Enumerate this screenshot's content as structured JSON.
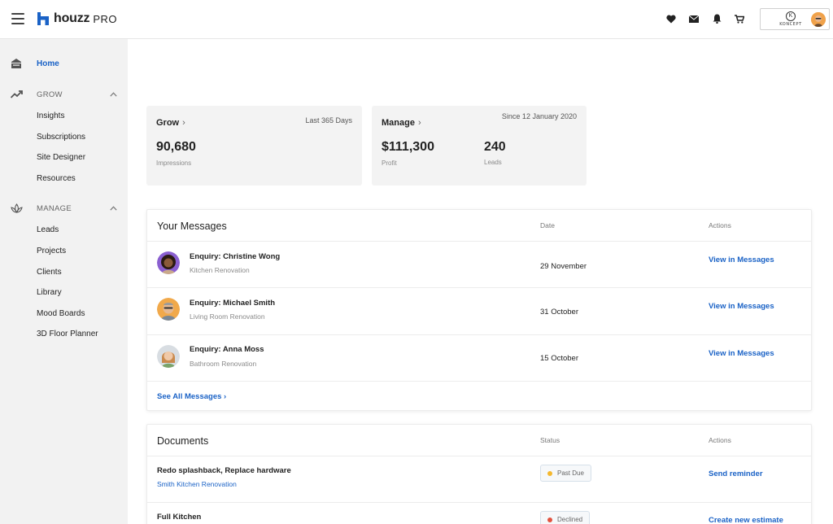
{
  "brand": {
    "name": "houzz",
    "suffix": "PRO",
    "color": "#1a62c6"
  },
  "account": {
    "brand_name": "KONCEPT"
  },
  "top_icons": [
    "heart-icon",
    "mail-icon",
    "bell-icon",
    "cart-icon"
  ],
  "sidebar": {
    "home": "Home",
    "grow": {
      "title": "GROW",
      "items": [
        "Insights",
        "Subscriptions",
        "Site Designer",
        "Resources"
      ]
    },
    "manage": {
      "title": "MANAGE",
      "items": [
        "Leads",
        "Projects",
        "Clients",
        "Library",
        "Mood Boards",
        "3D Floor Planner"
      ]
    }
  },
  "stats": {
    "grow": {
      "title": "Grow",
      "range": "Last 365 Days",
      "value": "90,680",
      "label": "Impressions"
    },
    "manage": {
      "title": "Manage",
      "range": "Since 12 January 2020",
      "profit_value": "$111,300",
      "profit_label": "Profit",
      "leads_value": "240",
      "leads_label": "Leads"
    }
  },
  "messages": {
    "title": "Your Messages",
    "col_date": "Date",
    "col_actions": "Actions",
    "rows": [
      {
        "title": "Enquiry: Christine Wong",
        "sub": "Kitchen Renovation",
        "date": "29 November",
        "action": "View in Messages"
      },
      {
        "title": "Enquiry: Michael Smith",
        "sub": "Living Room Renovation",
        "date": "31 October",
        "action": "View in Messages"
      },
      {
        "title": "Enquiry: Anna Moss",
        "sub": "Bathroom Renovation",
        "date": "15 October",
        "action": "View in Messages"
      }
    ],
    "see_all": "See All Messages ›"
  },
  "documents": {
    "title": "Documents",
    "col_status": "Status",
    "col_actions": "Actions",
    "rows": [
      {
        "title": "Redo splashback, Replace hardware",
        "sub": "Smith Kitchen Renovation",
        "status": "Past Due",
        "status_color": "#f5b82e",
        "action": "Send reminder"
      },
      {
        "title": "Full Kitchen",
        "sub": "",
        "status": "Declined",
        "status_color": "#e2523f",
        "action": "Create new estimate"
      }
    ]
  }
}
